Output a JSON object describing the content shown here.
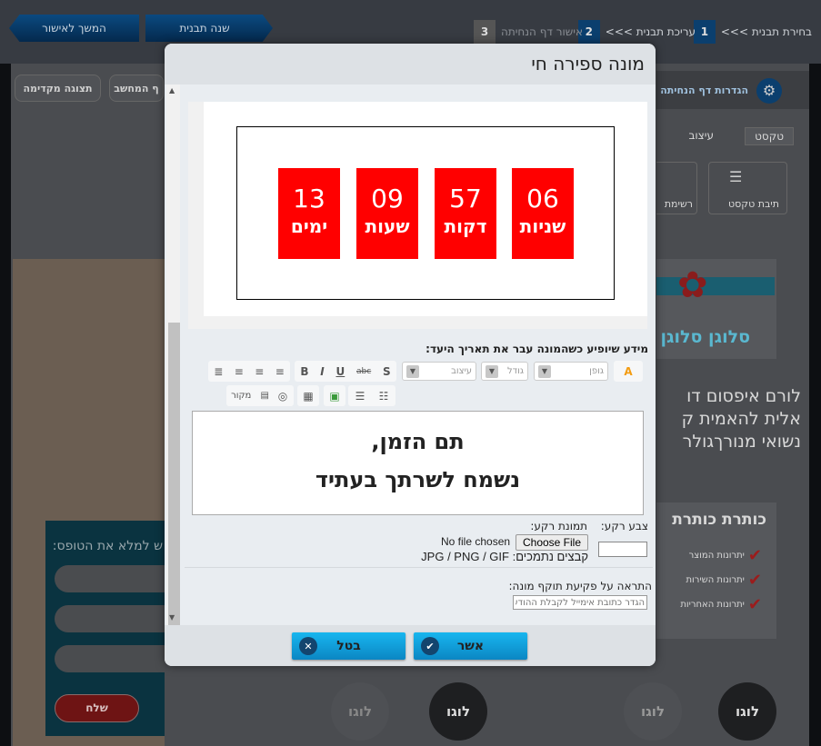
{
  "background": {
    "steps": [
      {
        "num": "1",
        "label": "בחירת תבנית >>>"
      },
      {
        "num": "2",
        "label": "עריכת תבנית >>>"
      },
      {
        "num": "3",
        "label": "אישור דף הנחיתה"
      }
    ],
    "change_template": "שנה תבנית",
    "continue": "המשך לאישור",
    "settings": "הגדרות דף הנחיתה",
    "preview": "תצוגה מקדימה",
    "computer": "ף המחשב",
    "tabs": [
      "טקסט",
      "עיצוב"
    ],
    "tools": [
      "תיבת טקסט",
      "רשימת"
    ],
    "slogan": "סלוגן סלוגן",
    "lorem": [
      "לורם איפסום דו",
      "אלית להאמית ק",
      "נשואי מנורךגולר"
    ],
    "heading": "כותרת כותרת",
    "benefits": [
      "יתרונות המוצר",
      "יתרונות השירות",
      "יתרונות האחריות"
    ],
    "form_title": "ש למלא את הטופס:",
    "send": "שלח",
    "logo": "לוגו"
  },
  "modal": {
    "title": "מונה ספירה חי",
    "counter": [
      {
        "value": "06",
        "unit": "שניות"
      },
      {
        "value": "57",
        "unit": "דקות"
      },
      {
        "value": "09",
        "unit": "שעות"
      },
      {
        "value": "13",
        "unit": "ימים"
      }
    ],
    "counter_color": "#ff0000",
    "expired_label": "מידע שיופיע כשהמונה עבר את תאריך היעד:",
    "toolbar": {
      "font_placeholder": "גופן",
      "size_placeholder": "גודל",
      "style_placeholder": "עיצוב",
      "bold": "B",
      "italic": "I",
      "underline": "U",
      "strike": "abc",
      "shadow": "S",
      "source": "מקור"
    },
    "editor_lines": [
      "תם הזמן,",
      "נשמח לשרתך בעתיד"
    ],
    "bg_color_label": "צבע רקע:",
    "bg_image_label": "תמונת רקע:",
    "choose_file": "Choose File",
    "no_file": "No file chosen",
    "formats": "קבצים נתמכים: JPG / PNG / GIF",
    "alert_label": "התראה על פקיעת תוקף מונה:",
    "alert_placeholder": "הגדר כתובת אימייל לקבלת ההודעה",
    "ok": "אשר",
    "cancel": "בטל"
  }
}
